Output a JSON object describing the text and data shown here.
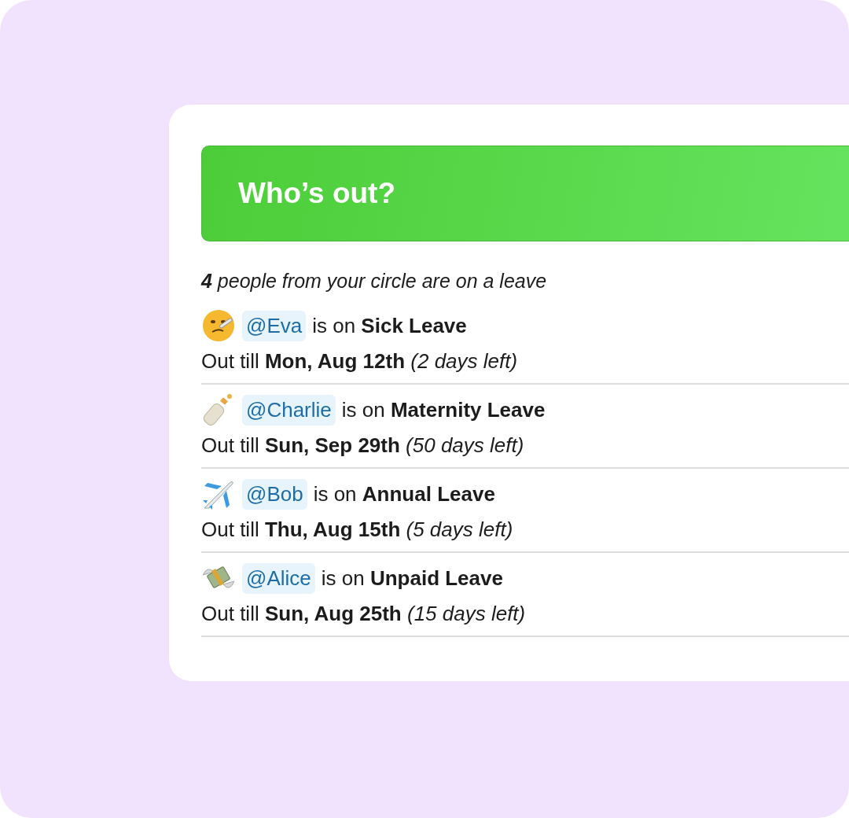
{
  "header": {
    "title": "Who’s out?"
  },
  "summary": "**4** people from your circle are on a leave",
  "entries": [
    {
      "kind": "sick",
      "mention": "@Eva",
      "status": "is on **Sick Leave**",
      "until": "Out till **Mon, Aug 12th** *(2 days left)*"
    },
    {
      "kind": "bottle",
      "mention": "@Charlie",
      "status": "is on **Maternity Leave**",
      "until": "Out till **Sun, Sep 29th** *(50 days left)*"
    },
    {
      "kind": "plane",
      "mention": "@Bob",
      "status": "is on **Annual Leave**",
      "until": "Out till **Thu, Aug 15th** *(5 days left)*"
    },
    {
      "kind": "money",
      "mention": "@Alice",
      "status": "is on **Unpaid Leave**",
      "until": "Out till **Sun, Aug 25th** *(15 days left)*"
    }
  ]
}
